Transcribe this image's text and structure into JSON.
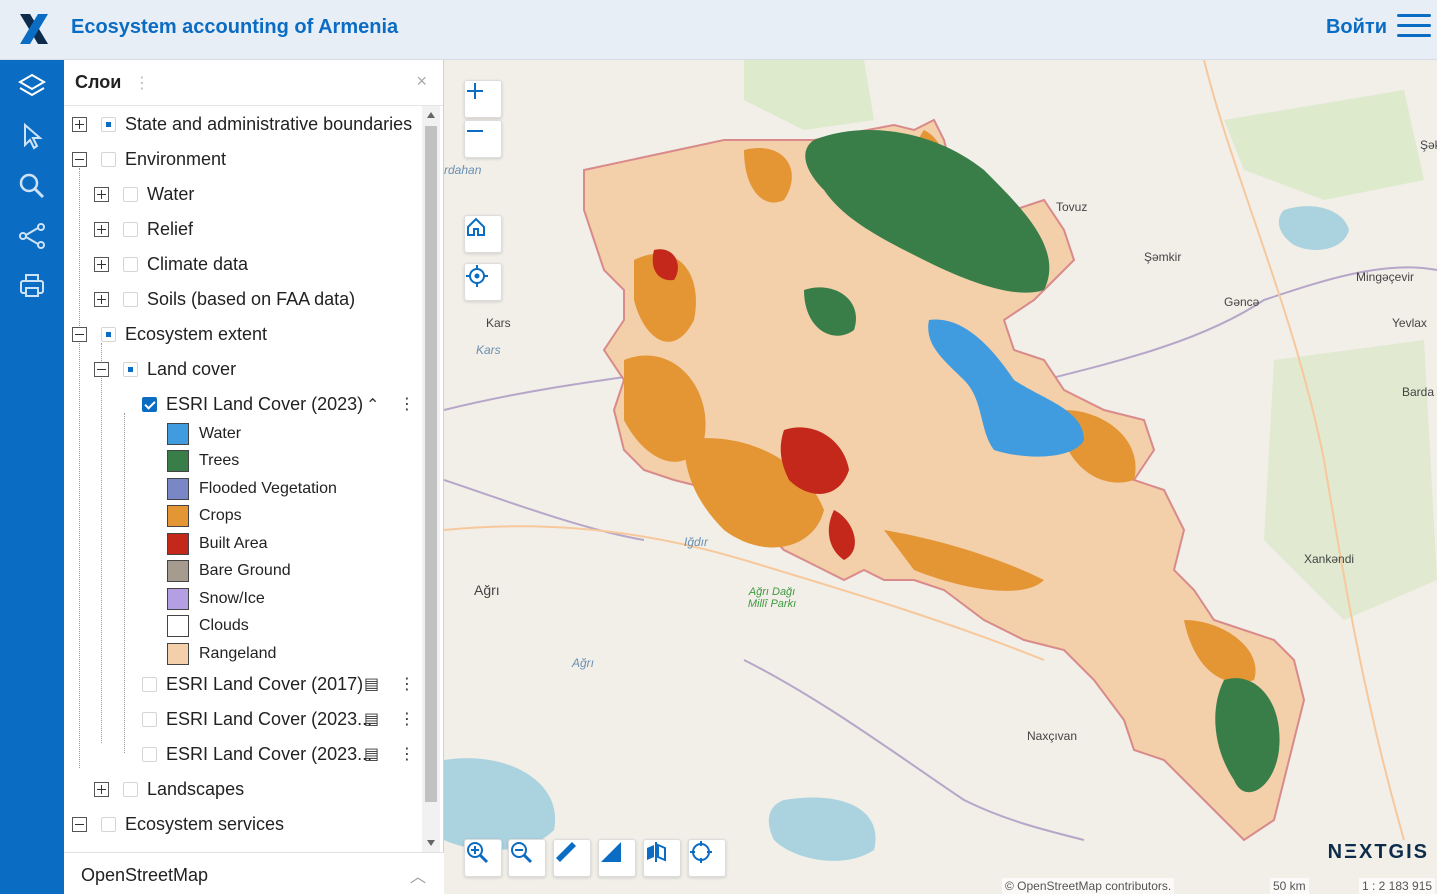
{
  "header": {
    "title": "Ecosystem accounting of Armenia",
    "login": "Войти"
  },
  "panel": {
    "title": "Слои",
    "basemap": "OpenStreetMap",
    "tree": [
      {
        "label": "State and administrative boundaries"
      },
      {
        "label": "Environment"
      },
      {
        "label": "Water"
      },
      {
        "label": "Relief"
      },
      {
        "label": "Climate data"
      },
      {
        "label": "Soils (based on FAA data)"
      },
      {
        "label": "Ecosystem extent"
      },
      {
        "label": "Land cover"
      },
      {
        "label": "ESRI Land Cover (2023)"
      },
      {
        "label": "ESRI Land Cover (2017)"
      },
      {
        "label": "ESRI Land Cover (2023..."
      },
      {
        "label": "ESRI Land Cover (2023..."
      },
      {
        "label": "Landscapes"
      },
      {
        "label": "Ecosystem services"
      }
    ],
    "legend": [
      {
        "label": "Water",
        "color": "#419bdf"
      },
      {
        "label": "Trees",
        "color": "#397d49"
      },
      {
        "label": "Flooded Vegetation",
        "color": "#7a87c6"
      },
      {
        "label": "Crops",
        "color": "#e49635"
      },
      {
        "label": "Built Area",
        "color": "#c4281b"
      },
      {
        "label": "Bare Ground",
        "color": "#a59b8f"
      },
      {
        "label": "Snow/Ice",
        "color": "#a8ebff"
      },
      {
        "label": "Clouds",
        "color": "#ffffff"
      },
      {
        "label": "Rangeland",
        "color": "#f3cfaa"
      }
    ]
  },
  "map": {
    "labels": {
      "kars": "Kars",
      "kars2": "Kars",
      "tovuz": "Tovuz",
      "samkir": "Şəmkir",
      "mingacevir": "Mingəçevir",
      "ganca": "Gəncə",
      "yevlax": "Yevlax",
      "barda": "Barda",
      "igdir": "Iğdır",
      "agri": "Ağrı",
      "agri2": "Ağrı",
      "agri_dagi": "Ağrı Dağı Millî Parkı",
      "xankandi": "Xankəndi",
      "naxcivan": "Naxçıvan",
      "sak": "Şək",
      "ardahan": "rdahan"
    },
    "attribution": "© OpenStreetMap contributors.",
    "scale": "50 km",
    "ratio": "1 : 2 183 915",
    "brand": "NΞXTGIS"
  }
}
